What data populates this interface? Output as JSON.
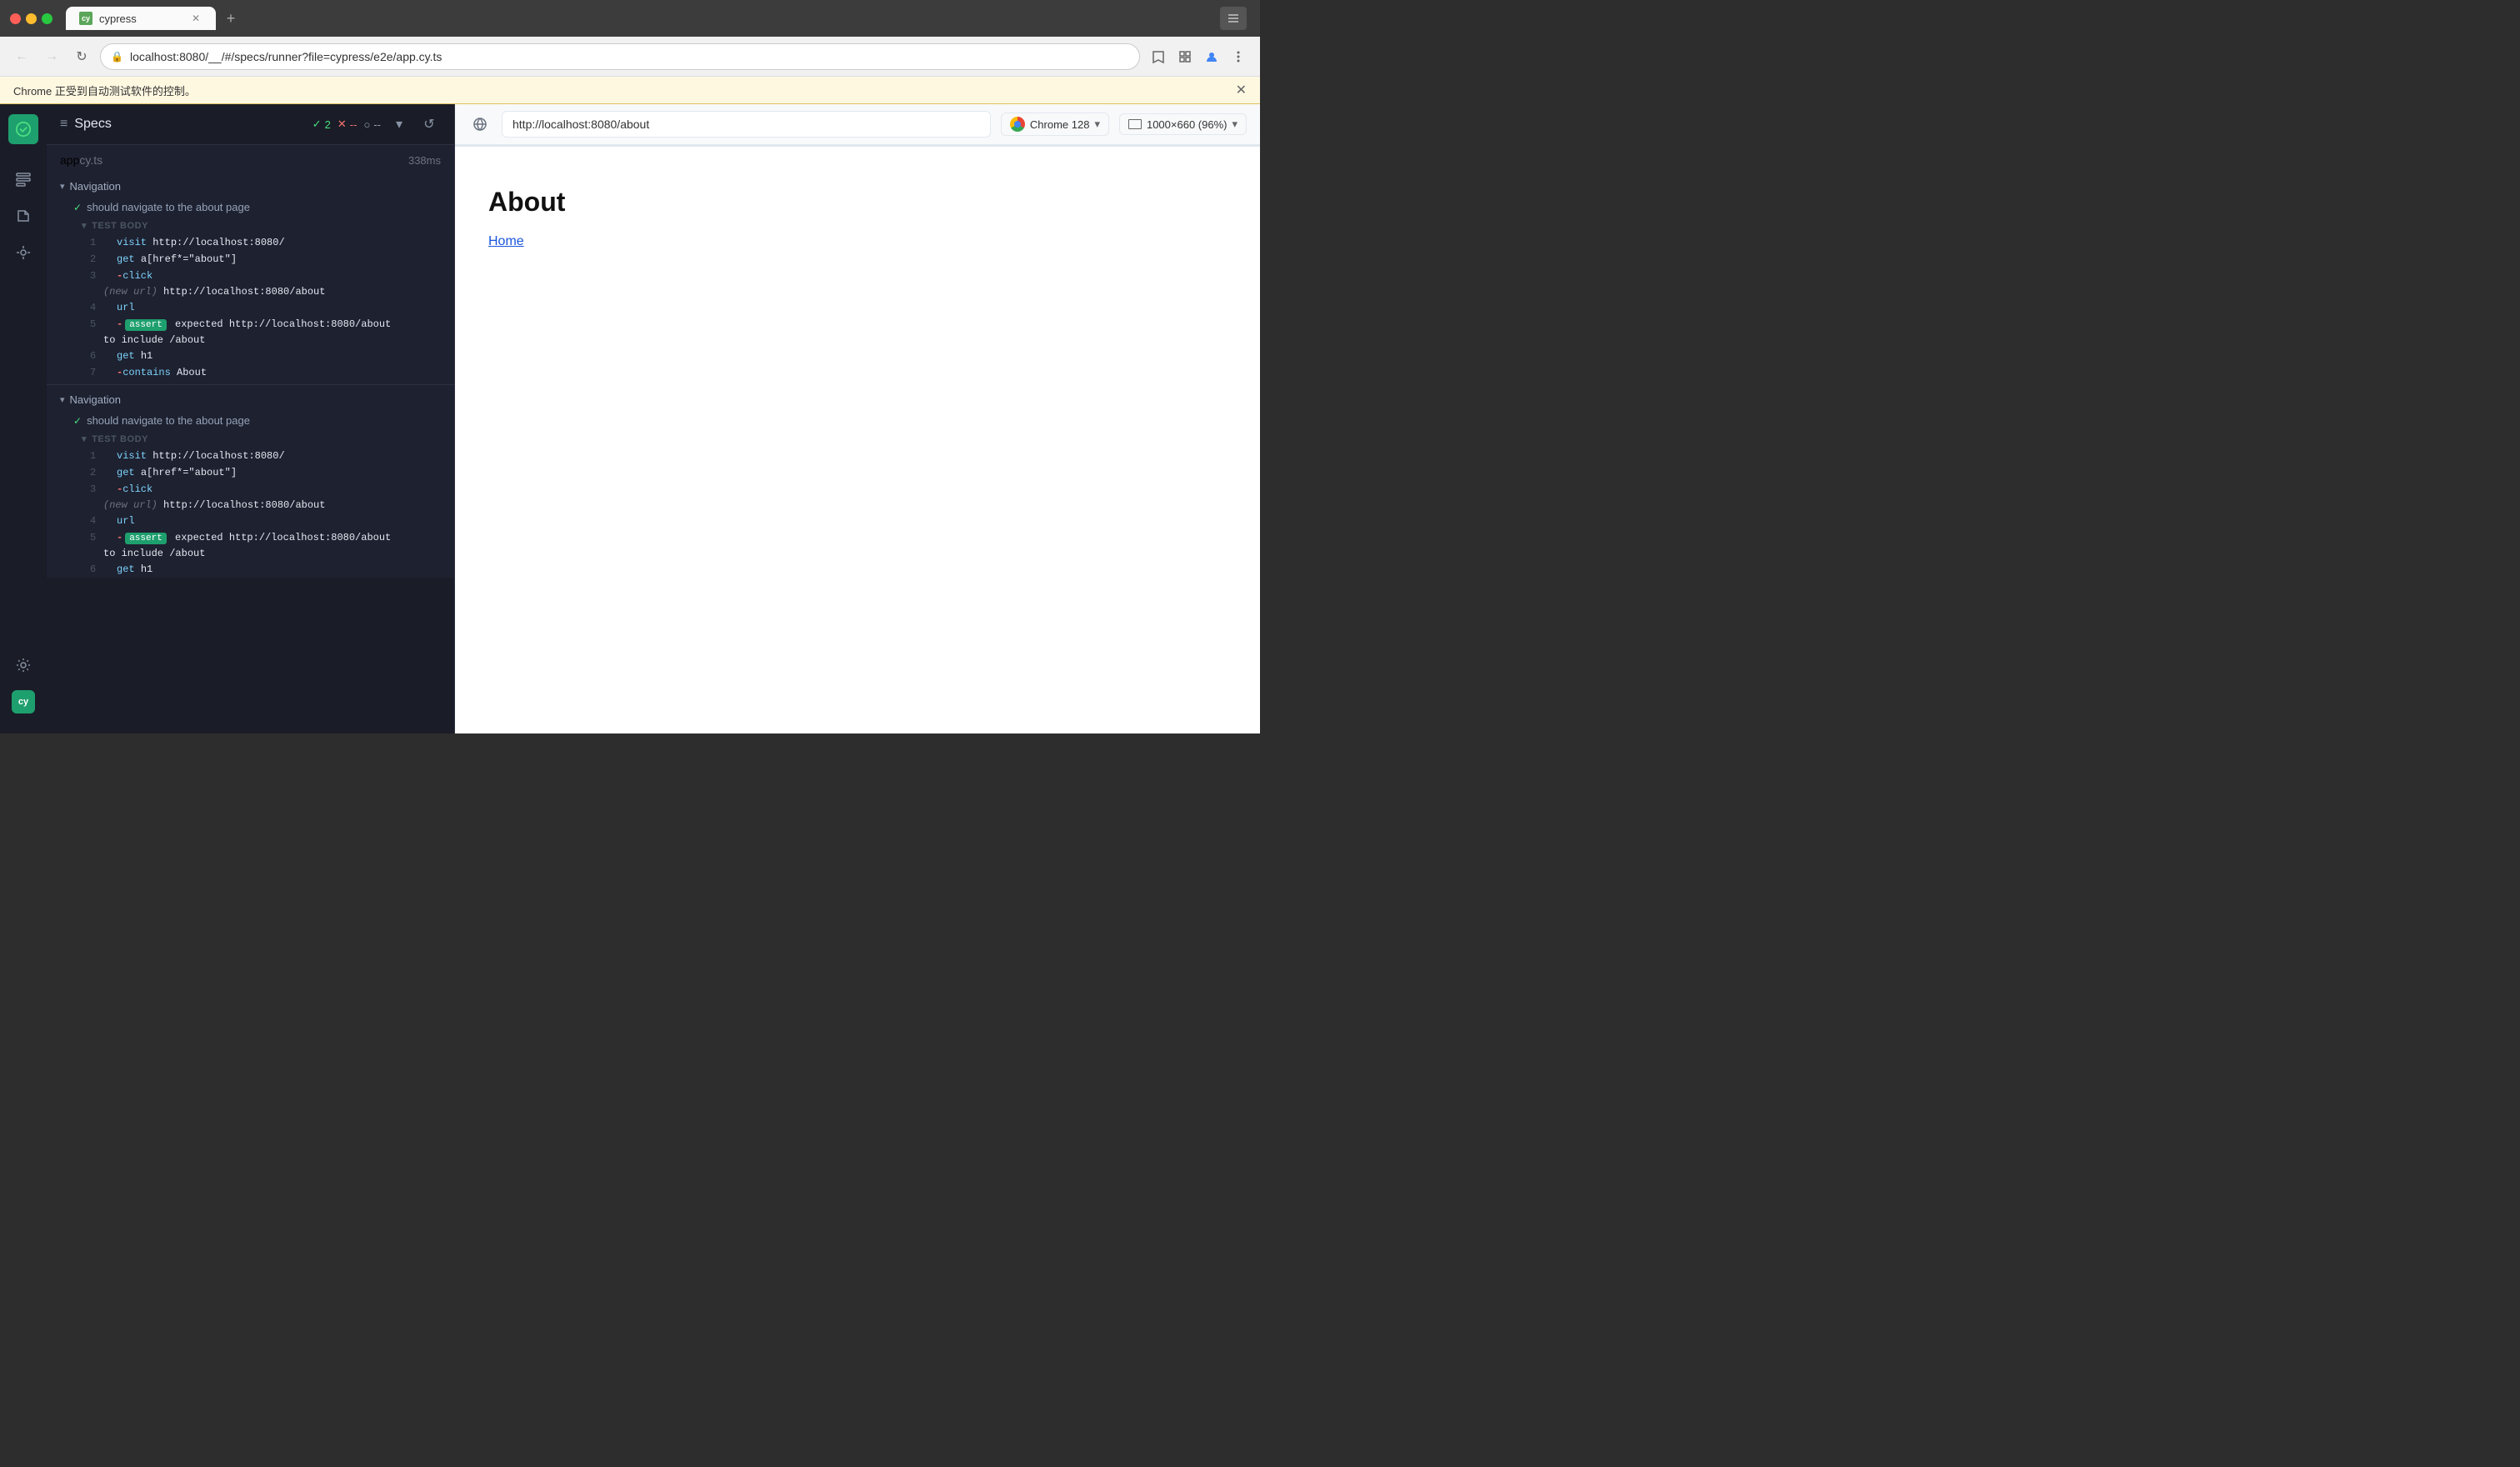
{
  "browser": {
    "tab_title": "cypress",
    "address": "localhost:8080/__/#/specs/runner?file=cypress/e2e/app.cy.ts",
    "automation_banner": "Chrome 正受到自动测试软件的控制。"
  },
  "preview": {
    "url": "http://localhost:8080/about",
    "browser_label": "Chrome 128",
    "size_label": "1000×660 (96%)",
    "page_heading": "About",
    "page_link": "Home"
  },
  "panel": {
    "title": "Specs",
    "stats": {
      "pass": "2",
      "pass_symbol": "✓",
      "fail_symbol": "✕",
      "fail": "--",
      "pending_symbol": "○",
      "pending": "--"
    },
    "file": {
      "name": "app",
      "ext": "cy.ts",
      "duration": "338ms"
    },
    "suites": [
      {
        "name": "Navigation",
        "tests": [
          {
            "name": "should navigate to the about page",
            "body_label": "TEST BODY",
            "lines": [
              {
                "num": "1",
                "cmd": "visit",
                "value": "http://localhost:8080/"
              },
              {
                "num": "2",
                "cmd": "get",
                "value": "a[href*=\"about\"]"
              },
              {
                "num": "3",
                "cmd": "-click",
                "value": "",
                "sub": "(new url)  http://localhost:8080/about"
              },
              {
                "num": "4",
                "cmd": "url",
                "value": ""
              },
              {
                "num": "5",
                "cmd": "-assert",
                "value": "expected http://localhost:8080/about",
                "value2": "to include /about",
                "is_assert": true
              },
              {
                "num": "6",
                "cmd": "get",
                "value": "h1"
              },
              {
                "num": "7",
                "cmd": "-contains",
                "value": "About"
              }
            ]
          }
        ]
      },
      {
        "name": "Navigation",
        "tests": [
          {
            "name": "should navigate to the about page",
            "body_label": "TEST BODY",
            "lines": [
              {
                "num": "1",
                "cmd": "visit",
                "value": "http://localhost:8080/"
              },
              {
                "num": "2",
                "cmd": "get",
                "value": "a[href*=\"about\"]"
              },
              {
                "num": "3",
                "cmd": "-click",
                "value": "",
                "sub": "(new url)  http://localhost:8080/about"
              },
              {
                "num": "4",
                "cmd": "url",
                "value": ""
              },
              {
                "num": "5",
                "cmd": "-assert",
                "value": "expected http://localhost:8080/about",
                "value2": "to include /about",
                "is_assert": true
              },
              {
                "num": "6",
                "cmd": "get",
                "value": "h1"
              }
            ]
          }
        ]
      }
    ]
  }
}
